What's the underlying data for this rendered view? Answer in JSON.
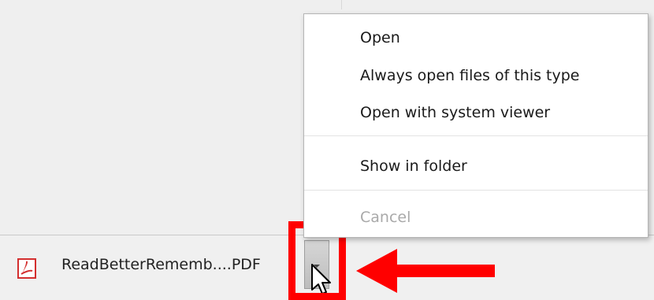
{
  "menu": {
    "items": [
      {
        "label": "Open"
      },
      {
        "label": "Always open files of this type"
      },
      {
        "label": "Open with system viewer"
      },
      {
        "label": "Show in folder"
      },
      {
        "label": "Cancel"
      }
    ]
  },
  "download": {
    "file_name": "ReadBetterRememb....PDF",
    "icon": "pdf-icon"
  },
  "colors": {
    "annotation": "#ff0000",
    "pdf": "#d32f2f"
  }
}
